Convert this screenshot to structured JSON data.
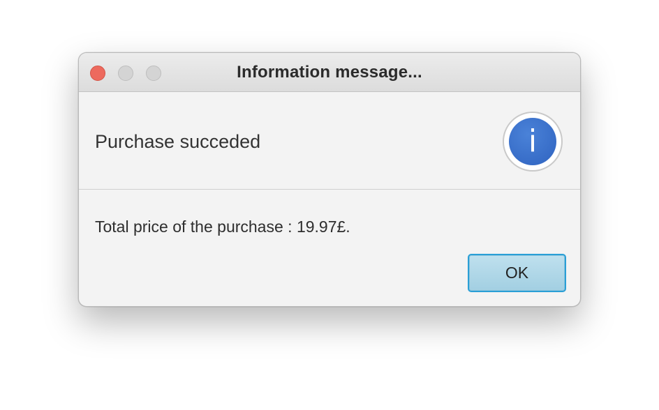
{
  "dialog": {
    "title": "Information message...",
    "header_text": "Purchase succeded",
    "content_text": "Total price of the purchase : 19.97£.",
    "ok_label": "OK",
    "icon": "information-icon",
    "info_glyph": "i"
  },
  "colors": {
    "close_button": "#ed6a5e",
    "inactive_button": "#d4d4d4",
    "info_icon": "#3a70cc",
    "ok_border": "#2a9fd6",
    "ok_fill": "#b3d9ea"
  }
}
